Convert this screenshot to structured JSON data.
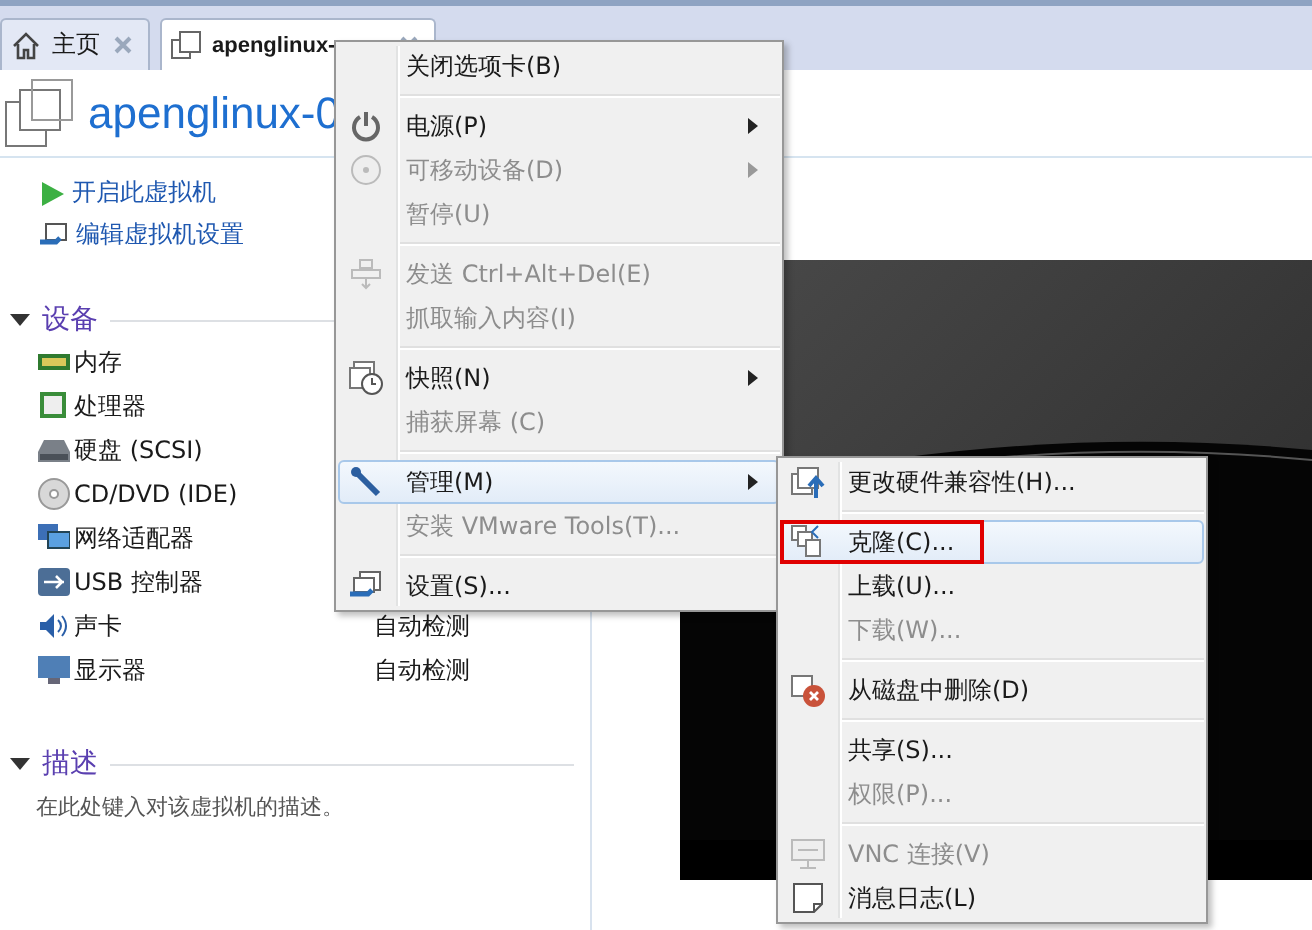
{
  "tabs": [
    {
      "label": "主页",
      "selected": false
    },
    {
      "label": "apenglinux-",
      "selected": true
    }
  ],
  "vm_title": "apenglinux-0",
  "actions": [
    "开启此虚拟机",
    "编辑虚拟机设置"
  ],
  "devices": {
    "title": "设备",
    "expanded": true,
    "items": [
      {
        "name": "内存"
      },
      {
        "name": "处理器"
      },
      {
        "name": "硬盘 (SCSI)"
      },
      {
        "name": "CD/DVD (IDE)"
      },
      {
        "name": "网络适配器"
      },
      {
        "name": "USB 控制器"
      },
      {
        "name": "声卡",
        "value": "自动检测"
      },
      {
        "name": "显示器",
        "value": "自动检测"
      }
    ]
  },
  "description": {
    "title": "描述",
    "expanded": true,
    "text": "在此处键入对该虚拟机的描述。"
  },
  "context_menu": {
    "groups": [
      [
        {
          "label": "关闭选项卡(B)",
          "disabled": false,
          "submenu": false,
          "selected": false
        }
      ],
      [
        {
          "label": "电源(P)",
          "disabled": false,
          "submenu": true,
          "selected": false
        },
        {
          "label": "可移动设备(D)",
          "disabled": true,
          "submenu": true,
          "selected": false
        },
        {
          "label": "暂停(U)",
          "disabled": true,
          "submenu": false,
          "selected": false
        }
      ],
      [
        {
          "label": "发送 Ctrl+Alt+Del(E)",
          "disabled": true,
          "submenu": false,
          "selected": false
        },
        {
          "label": "抓取输入内容(I)",
          "disabled": true,
          "submenu": false,
          "selected": false
        }
      ],
      [
        {
          "label": "快照(N)",
          "disabled": false,
          "submenu": true,
          "selected": false
        },
        {
          "label": "捕获屏幕 (C)",
          "disabled": true,
          "submenu": false,
          "selected": false
        }
      ],
      [
        {
          "label": "管理(M)",
          "disabled": false,
          "submenu": true,
          "selected": true
        },
        {
          "label": "安装 VMware Tools(T)...",
          "disabled": true,
          "submenu": false,
          "selected": false
        }
      ],
      [
        {
          "label": "设置(S)...",
          "disabled": false,
          "submenu": false,
          "selected": false
        }
      ]
    ]
  },
  "submenu": {
    "groups": [
      [
        {
          "label": "更改硬件兼容性(H)...",
          "disabled": false,
          "selected": false,
          "annotated": false
        }
      ],
      [
        {
          "label": "克隆(C)...",
          "disabled": false,
          "selected": true,
          "annotated": true
        },
        {
          "label": "上载(U)...",
          "disabled": false,
          "selected": false,
          "annotated": false
        },
        {
          "label": "下载(W)...",
          "disabled": true,
          "selected": false,
          "annotated": false
        }
      ],
      [
        {
          "label": "从磁盘中删除(D)",
          "disabled": false,
          "selected": false,
          "annotated": false
        }
      ],
      [
        {
          "label": "共享(S)...",
          "disabled": false,
          "selected": false,
          "annotated": false
        },
        {
          "label": "权限(P)...",
          "disabled": true,
          "selected": false,
          "annotated": false
        }
      ],
      [
        {
          "label": "VNC 连接(V)",
          "disabled": true,
          "selected": false,
          "annotated": false
        },
        {
          "label": "消息日志(L)",
          "disabled": false,
          "selected": false,
          "annotated": false
        }
      ]
    ]
  }
}
